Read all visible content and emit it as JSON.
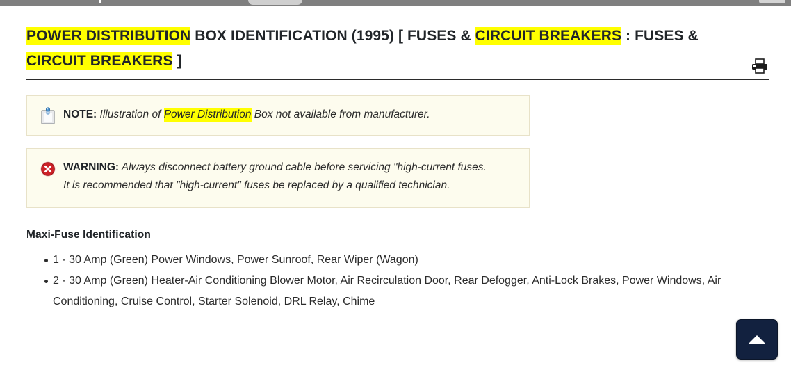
{
  "chrome": {
    "present": true
  },
  "header": {
    "title_segments": [
      {
        "text": "POWER DISTRIBUTION",
        "highlight": true
      },
      {
        "text": " BOX IDENTIFICATION (1995) [ FUSES & ",
        "highlight": false
      },
      {
        "text": "CIRCUIT BREAKERS",
        "highlight": true
      },
      {
        "text": " : FUSES & ",
        "highlight": false
      },
      {
        "text": "CIRCUIT BREAKERS",
        "highlight": true
      },
      {
        "text": " ]",
        "highlight": false
      }
    ],
    "title_plain": "POWER DISTRIBUTION BOX IDENTIFICATION (1995) [ FUSES & CIRCUIT BREAKERS : FUSES & CIRCUIT BREAKERS ]",
    "print_icon": "printer-icon"
  },
  "note": {
    "icon": "note-clipboard-icon",
    "label": "NOTE:",
    "segments": [
      {
        "text": " Illustration of ",
        "highlight": false
      },
      {
        "text": "Power Distribution",
        "highlight": true
      },
      {
        "text": " Box not available from manufacturer.",
        "highlight": false
      }
    ],
    "text_plain": "Illustration of Power Distribution Box not available from manufacturer."
  },
  "warning": {
    "icon": "error-circle-x-icon",
    "label": "WARNING:",
    "text": " Always disconnect battery ground cable before servicing \"high-current fuses. It is recommended that \"high-current\" fuses be replaced by a qualified technician."
  },
  "section": {
    "heading": "Maxi-Fuse Identification",
    "items": [
      "1 - 30 Amp (Green) Power Windows, Power Sunroof, Rear Wiper (Wagon)",
      "2 - 30 Amp (Green) Heater-Air Conditioning Blower Motor, Air Recirculation Door, Rear Defogger, Anti-Lock Brakes, Power Windows, Air Conditioning, Cruise Control, Starter Solenoid, DRL Relay, Chime"
    ]
  },
  "scroll_top": {
    "icon": "arrow-up-icon",
    "label": ""
  },
  "colors": {
    "highlight": "#ffff00",
    "callout_bg": "#fdfcee",
    "callout_border": "#e8e2c8",
    "text": "#2b2b2b",
    "scroll_top_bg": "#12213f",
    "warning_icon": "#cc2127"
  }
}
